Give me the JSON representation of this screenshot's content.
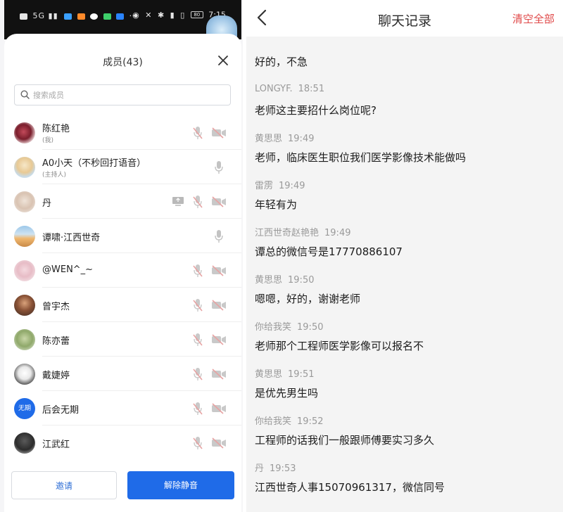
{
  "status_bar": {
    "left_text": "5G ▮▮",
    "time": "7:15",
    "battery": "80"
  },
  "members_panel": {
    "title": "成员(43)",
    "search_placeholder": "搜索成员",
    "members": [
      {
        "name": "陈红艳",
        "role": "(我)",
        "avatar": "rose-avatar"
      },
      {
        "name": "A0小天（不秒回打语音）",
        "role": "(主持人)",
        "avatar": "cartoon-avatar"
      },
      {
        "name": "丹",
        "role": "",
        "avatar": "sketch-avatar"
      },
      {
        "name": "谭啸·江西世奇",
        "role": "",
        "avatar": "landscape-avatar"
      },
      {
        "name": "@WEN^_~",
        "role": "",
        "avatar": "girl-avatar"
      },
      {
        "name": "曾宇杰",
        "role": "",
        "avatar": "photo-avatar"
      },
      {
        "name": "陈亦蕾",
        "role": "",
        "avatar": "plant-avatar"
      },
      {
        "name": "戴婕婷",
        "role": "",
        "avatar": "drawing-avatar"
      },
      {
        "name": "后会无期",
        "role": "",
        "avatar": "text-avatar",
        "avatar_text": "无期"
      },
      {
        "name": "江武红",
        "role": "",
        "avatar": "dark-avatar"
      }
    ],
    "invite_label": "邀请",
    "unmute_label": "解除静音"
  },
  "chat_panel": {
    "title": "聊天记录",
    "clear_label": "清空全部",
    "messages": [
      {
        "sender": "",
        "time": "",
        "text": "好的，不急"
      },
      {
        "sender": "LONGYF.",
        "time": "18:51",
        "text": "老师这主要招什么岗位呢?"
      },
      {
        "sender": "黄思思",
        "time": "19:49",
        "text": "老师，临床医生职位我们医学影像技术能做吗"
      },
      {
        "sender": "雷雳",
        "time": "19:49",
        "text": "年轻有为"
      },
      {
        "sender": "江西世奇赵艳艳",
        "time": "19:49",
        "text": "谭总的微信号是17770886107"
      },
      {
        "sender": "黄思思",
        "time": "19:50",
        "text": "嗯嗯，好的，谢谢老师"
      },
      {
        "sender": "你给我笑",
        "time": "19:50",
        "text": "老师那个工程师医学影像可以报名不"
      },
      {
        "sender": "黄思思",
        "time": "19:51",
        "text": "是优先男生吗"
      },
      {
        "sender": "你给我笑",
        "time": "19:52",
        "text": "工程师的话我们一般跟师傅要实习多久"
      },
      {
        "sender": "丹",
        "time": "19:53",
        "text": "江西世奇人事15070961317，微信同号"
      }
    ]
  },
  "colors": {
    "accent_blue": "#1f6be8",
    "clear_red": "#e04a4a",
    "icon_gray": "#b9b9b9",
    "muted_red": "#e8b4b4"
  }
}
